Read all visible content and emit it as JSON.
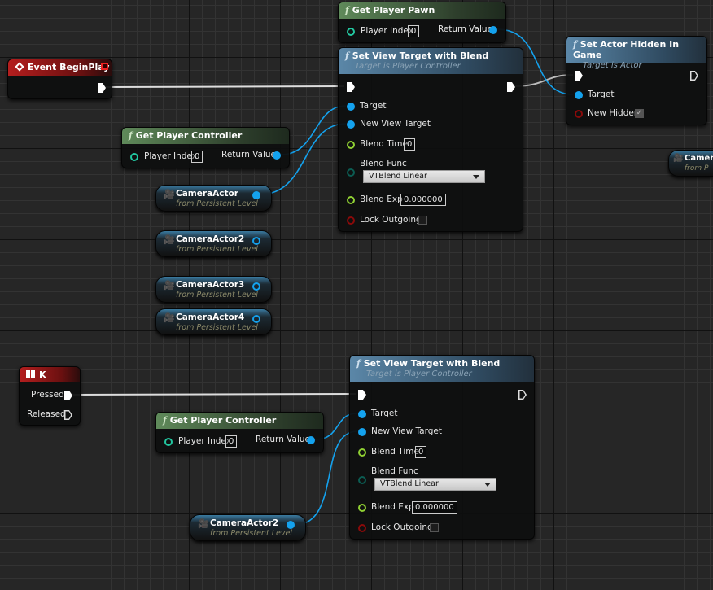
{
  "colors": {
    "exec": "#ffffff",
    "object": "#14a2ee",
    "integer": "#22c7a0",
    "float": "#8fcf33",
    "enum": "#0b5c52",
    "bool": "#8a0a0a",
    "event_header": "#b41e1e",
    "function_header": "#5f8a5a",
    "target_function_header": "#5b87a8"
  },
  "event_begin_play": {
    "title": "Event BeginPlay",
    "icon": "event-diamond-icon"
  },
  "get_player_pawn": {
    "title": "Get Player Pawn",
    "player_index_label": "Player Index",
    "player_index_value": "0",
    "return_label": "Return Value"
  },
  "svt1": {
    "title": "Set View Target with Blend",
    "subtitle": "Target is Player Controller",
    "target": "Target",
    "new_view_target": "New View Target",
    "blend_time": "Blend Time",
    "blend_time_value": "0",
    "blend_func": "Blend Func",
    "blend_func_value": "VTBlend Linear",
    "blend_exp": "Blend Exp",
    "blend_exp_value": "0.000000",
    "lock_outgoing": "Lock Outgoing",
    "lock_outgoing_checked": false
  },
  "set_actor_hidden": {
    "title": "Set Actor Hidden In Game",
    "subtitle": "Target is Actor",
    "target": "Target",
    "new_hidden": "New Hidden",
    "new_hidden_checked": true,
    "check_glyph": "✓"
  },
  "gpc1": {
    "title": "Get Player Controller",
    "player_index_label": "Player Index",
    "player_index_value": "0",
    "return_label": "Return Value"
  },
  "vars": [
    {
      "name": "CameraActor",
      "from": "from Persistent Level",
      "connected": true
    },
    {
      "name": "CameraActor2",
      "from": "from Persistent Level",
      "connected": false
    },
    {
      "name": "CameraActor3",
      "from": "from Persistent Level",
      "connected": false
    },
    {
      "name": "CameraActor4",
      "from": "from Persistent Level",
      "connected": false
    },
    {
      "name": "Camer",
      "from": "from P",
      "connected": false
    },
    {
      "name": "CameraActor2",
      "from": "from Persistent Level",
      "connected": true
    }
  ],
  "key_k": {
    "title": "K",
    "icon": "keyboard-icon",
    "pressed": "Pressed",
    "released": "Released"
  },
  "gpc2": {
    "title": "Get Player Controller",
    "player_index_label": "Player Index",
    "player_index_value": "0",
    "return_label": "Return Value"
  },
  "svt2": {
    "title": "Set View Target with Blend",
    "subtitle": "Target is Player Controller",
    "target": "Target",
    "new_view_target": "New View Target",
    "blend_time": "Blend Time",
    "blend_time_value": "0",
    "blend_func": "Blend Func",
    "blend_func_value": "VTBlend Linear",
    "blend_exp": "Blend Exp",
    "blend_exp_value": "0.000000",
    "lock_outgoing": "Lock Outgoing",
    "lock_outgoing_checked": false
  },
  "function_glyph": "f",
  "camera_glyph": "🎥"
}
